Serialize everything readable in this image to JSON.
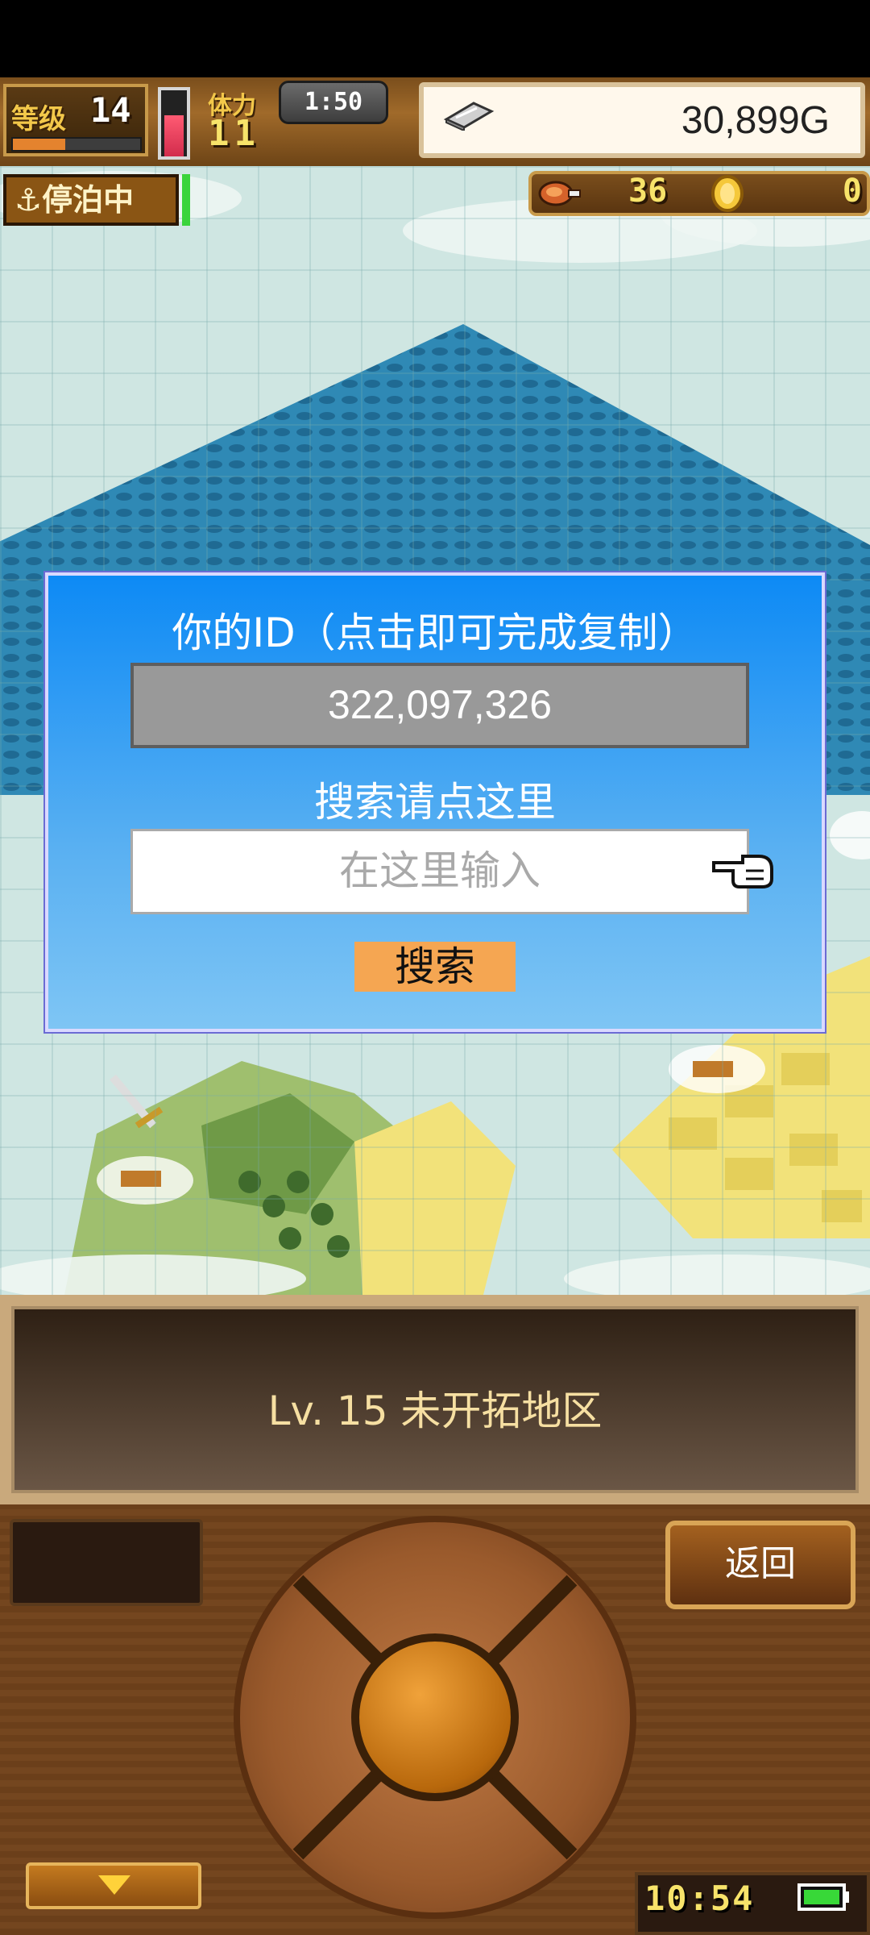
{
  "hud": {
    "level_label": "等级",
    "level_value": "14",
    "exp_progress": 0.42,
    "stamina_label": "体力",
    "stamina_value": "11",
    "stamina_progress": 0.62,
    "timer": "1:50",
    "gold_value": "30,899G"
  },
  "status": {
    "docked": "⚓停泊中",
    "food_value": "36",
    "coin_value": "0"
  },
  "dialog": {
    "title": "你的ID（点击即可完成复制）",
    "player_id": "322,097,326",
    "search_hint": "搜索请点这里",
    "search_placeholder": "在这里输入",
    "search_button": "搜索"
  },
  "region": {
    "label": "Lv. 15 未开拓地区"
  },
  "controls": {
    "back_button": "返回",
    "clock": "10:54"
  },
  "icons": {
    "gold": "silver-ingot-icon",
    "food": "meat-icon",
    "coin": "gold-coin-icon",
    "pointer": "hand-pointer-icon",
    "battery": "battery-icon"
  },
  "colors": {
    "dialog_blue": "#0d8af5",
    "button_orange": "#f5a652",
    "hud_brown": "#7a4e1c",
    "accent_yellow": "#f7e36a"
  }
}
